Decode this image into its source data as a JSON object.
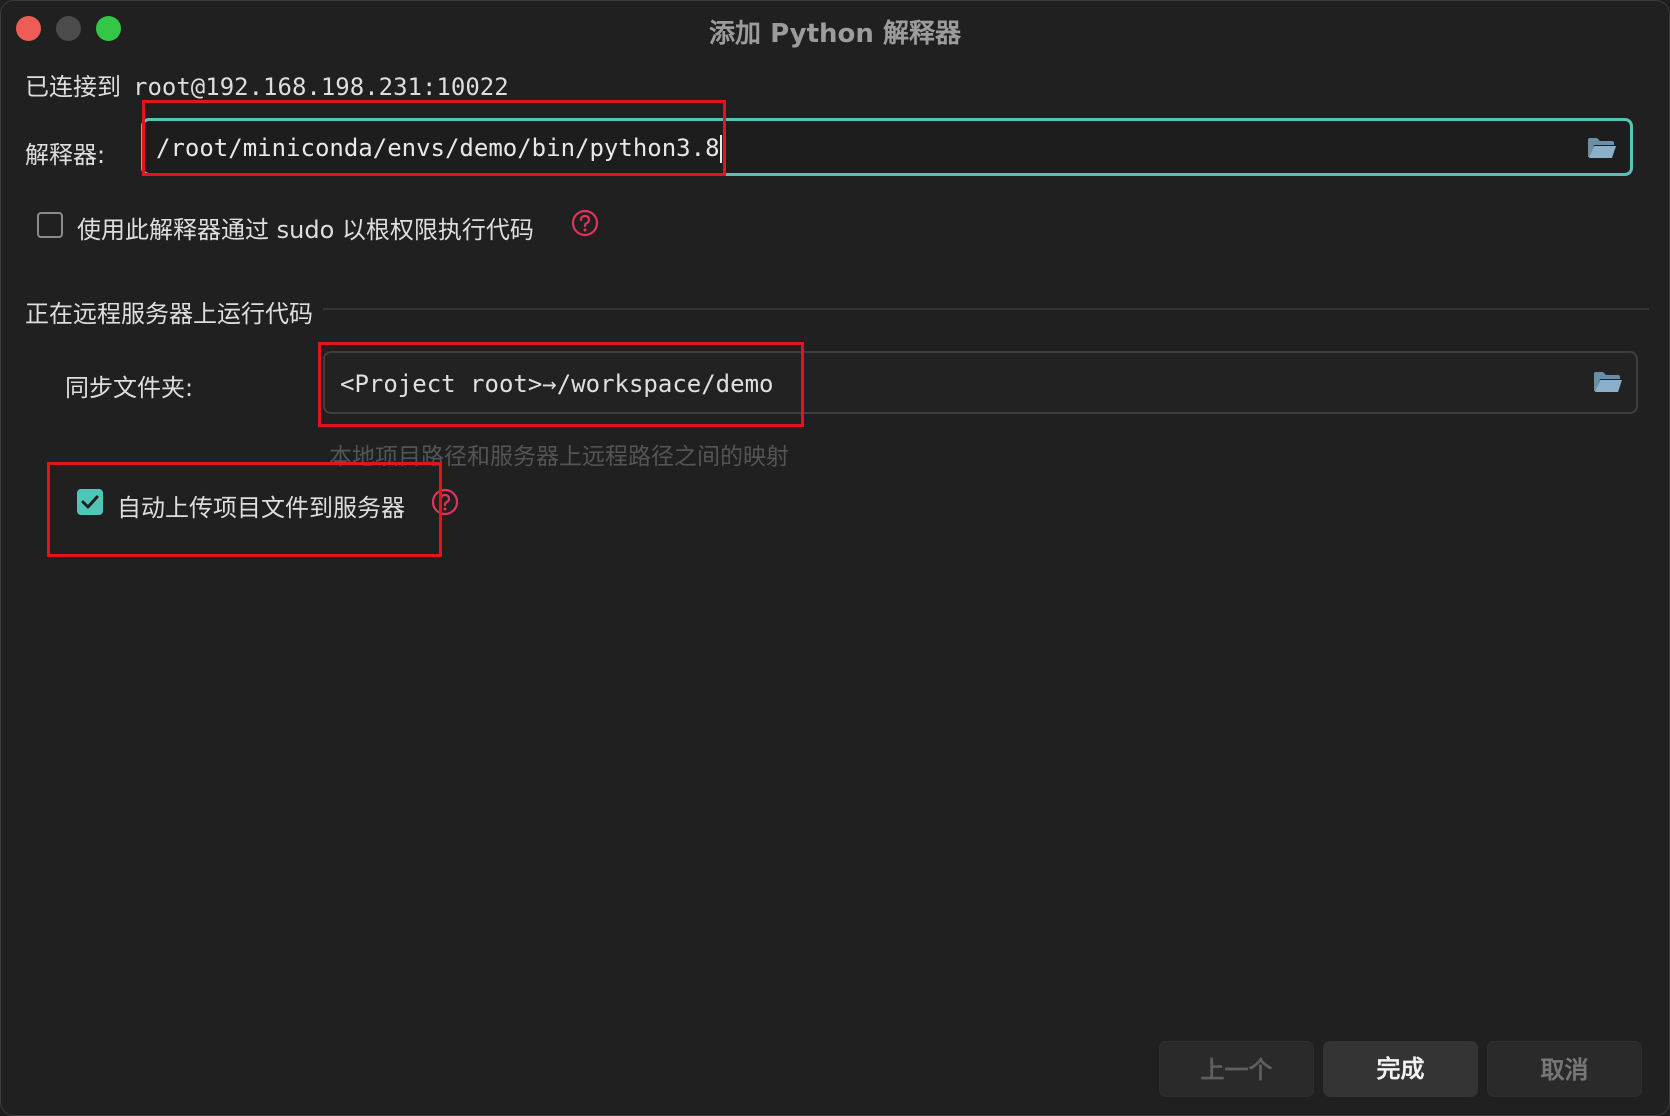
{
  "window": {
    "title": "添加 Python 解释器"
  },
  "connection": {
    "prefix": "已连接到",
    "host": "root@192.168.198.231:10022"
  },
  "interpreter": {
    "label": "解释器:",
    "value": "/root/miniconda/envs/demo/bin/python3.8",
    "browse_icon": "folder-icon"
  },
  "sudo_option": {
    "label": "使用此解释器通过 sudo 以根权限执行代码",
    "checked": false,
    "help_icon": "question-circle-icon"
  },
  "remote_section": {
    "title": "正在远程服务器上运行代码",
    "sync_folder": {
      "label": "同步文件夹:",
      "value": "<Project root>→/workspace/demo",
      "hint": "本地项目路径和服务器上远程路径之间的映射",
      "browse_icon": "folder-icon"
    },
    "auto_upload": {
      "label": "自动上传项目文件到服务器",
      "checked": true,
      "help_icon": "question-circle-icon"
    }
  },
  "buttons": {
    "previous": "上一个",
    "finish": "完成",
    "cancel": "取消"
  },
  "colors": {
    "accent": "#56c3b7",
    "help": "#e4325c",
    "highlight_box": "#e3141b",
    "close": "#ee5d55",
    "zoom": "#34c646"
  }
}
